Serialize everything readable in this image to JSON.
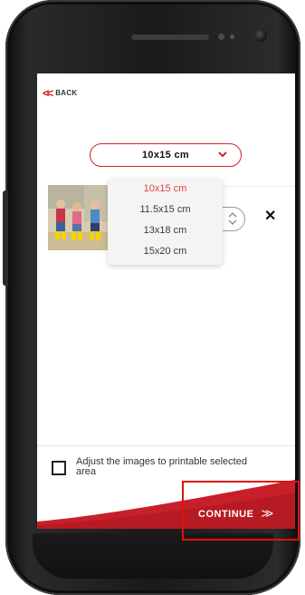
{
  "header": {
    "back_label": "BACK"
  },
  "size_select": {
    "value": "10x15 cm",
    "options": [
      "10x15 cm",
      "11.5x15 cm",
      "13x18 cm",
      "15x20 cm"
    ],
    "selected_index": 0
  },
  "photo_item": {
    "remove_symbol": "✕"
  },
  "adjust": {
    "label": "Adjust the images to printable selected area",
    "checked": false
  },
  "footer": {
    "continue_label": "CONTINUE",
    "continue_arrow": "»"
  },
  "colors": {
    "accent": "#d5232b",
    "footer": "#c8202a",
    "highlight": "#e01010"
  },
  "icons": {
    "back": "double-chevron-left-icon",
    "select": "chevron-down-icon",
    "stepper": "up-down-arrows-icon",
    "remove": "close-icon",
    "continue": "double-chevron-right-icon"
  }
}
